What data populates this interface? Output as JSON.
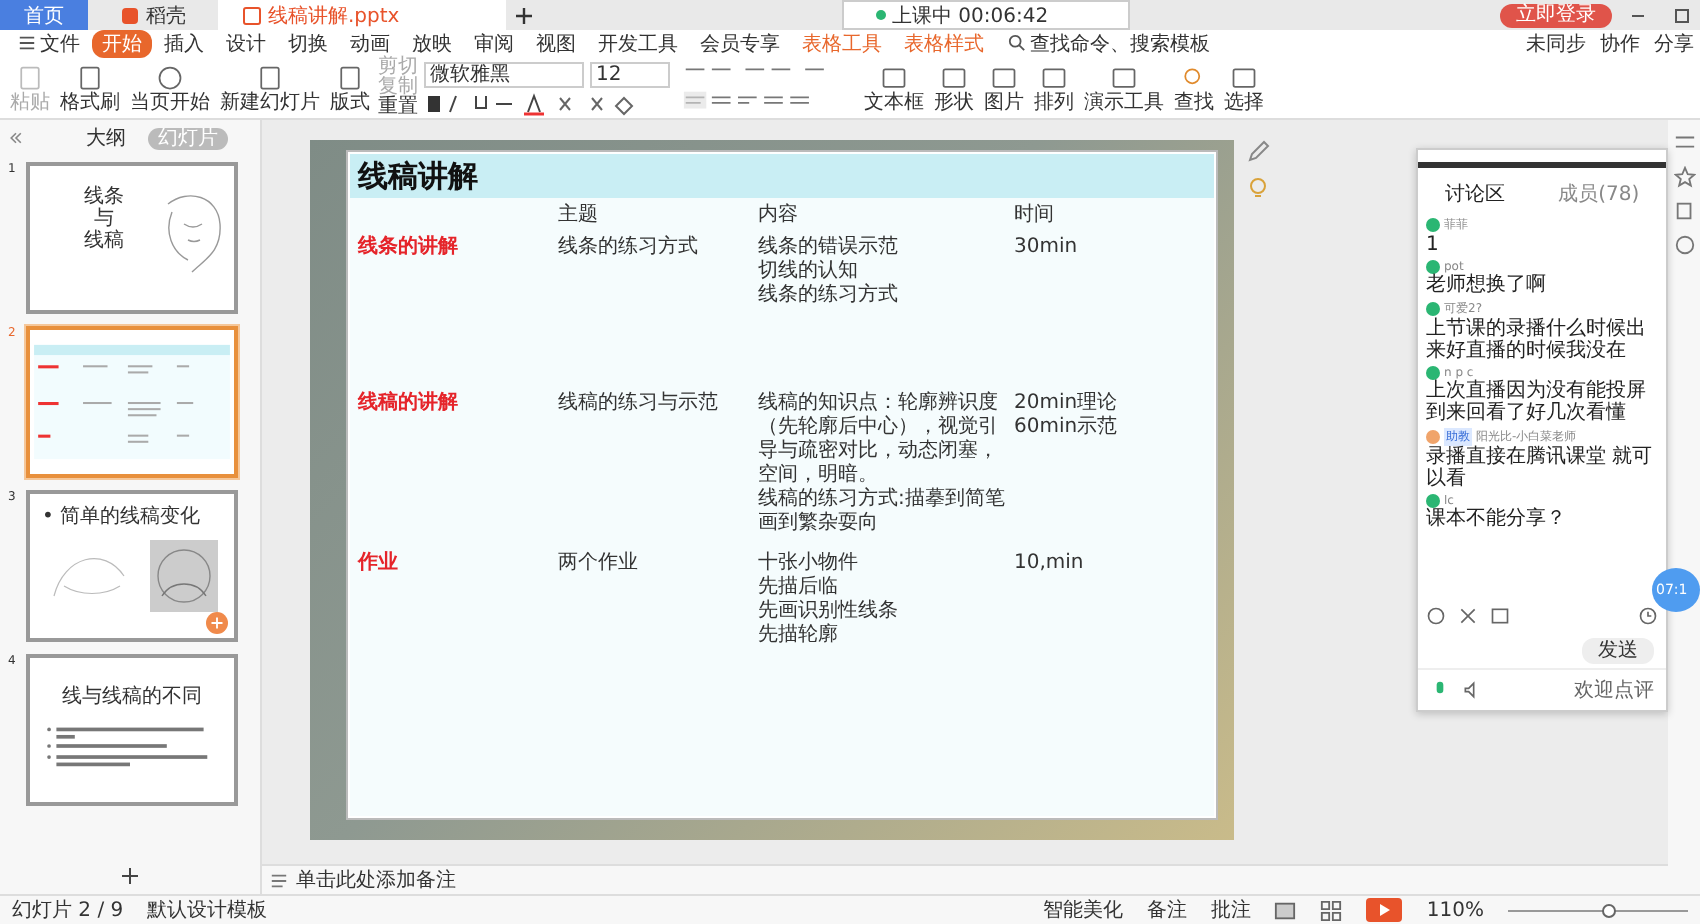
{
  "title_bar": {
    "tabs": [
      {
        "label": "首页",
        "kind": "home",
        "selected": false
      },
      {
        "label": "稻壳",
        "kind": "docer",
        "selected": false
      },
      {
        "label": "线稿讲解.pptx",
        "kind": "file",
        "selected": true
      }
    ],
    "class_status": "上课中 00:06:42",
    "login": "立即登录"
  },
  "menu": {
    "file": "文件",
    "tabs": [
      {
        "label": "开始",
        "selected": true
      },
      {
        "label": "插入",
        "selected": false
      },
      {
        "label": "设计",
        "selected": false
      },
      {
        "label": "切换",
        "selected": false
      },
      {
        "label": "动画",
        "selected": false
      },
      {
        "label": "放映",
        "selected": false
      },
      {
        "label": "审阅",
        "selected": false
      },
      {
        "label": "视图",
        "selected": false
      },
      {
        "label": "开发工具",
        "selected": false
      },
      {
        "label": "会员专享",
        "selected": false
      },
      {
        "label": "表格工具",
        "selected": false
      },
      {
        "label": "表格样式",
        "selected": false
      }
    ],
    "search": "查找命令、搜索模板",
    "actions": [
      "未同步",
      "协作",
      "分享"
    ]
  },
  "ribbon": {
    "left": [
      {
        "label": "粘贴",
        "kind": "paste",
        "disabled": true
      },
      {
        "label": "格式刷",
        "kind": "brush",
        "disabled": false
      },
      {
        "label": "当页开始",
        "kind": "play",
        "disabled": false
      },
      {
        "label": "新建幻灯片",
        "kind": "slide",
        "disabled": false
      },
      {
        "label": "版式",
        "kind": "layout",
        "disabled": false
      }
    ],
    "small": [
      {
        "label": "剪切",
        "disabled": true
      },
      {
        "label": "复制",
        "disabled": true
      },
      {
        "label": "重置",
        "disabled": false
      }
    ],
    "font": "微软雅黑",
    "size": "12",
    "right": [
      {
        "label": "文本框",
        "kind": "textbox",
        "disabled": false
      },
      {
        "label": "形状",
        "kind": "shape",
        "disabled": false
      },
      {
        "label": "图片",
        "kind": "picture",
        "disabled": false
      },
      {
        "label": "排列",
        "kind": "arrange",
        "disabled": false
      },
      {
        "label": "演示工具",
        "kind": "screen",
        "disabled": false
      },
      {
        "label": "查找",
        "kind": "find",
        "disabled": false
      },
      {
        "label": "选择",
        "kind": "select",
        "disabled": false
      }
    ]
  },
  "slides_panel": {
    "tabs": [
      {
        "label": "大纲",
        "selected": false
      },
      {
        "label": "幻灯片",
        "selected": true
      }
    ],
    "slides": [
      {
        "number": "1",
        "kind": "title",
        "selected": false,
        "lines": [
          "线条",
          "与",
          "线稿"
        ]
      },
      {
        "number": "2",
        "kind": "table",
        "selected": true
      },
      {
        "number": "3",
        "kind": "images",
        "selected": false,
        "lines": [
          "• 简单的线稿变化"
        ]
      },
      {
        "number": "4",
        "kind": "bullets",
        "selected": false,
        "lines": [
          "线与线稿的不同"
        ]
      }
    ]
  },
  "slide": {
    "title": "线稿讲解",
    "columns": [
      "主题",
      "内容",
      "时间"
    ],
    "rows": [
      {
        "heading": "线条的讲解",
        "topic": "线条的练习方式",
        "content": [
          "线条的错误示范",
          "切线的认知",
          "线条的练习方式"
        ],
        "time": [
          "30min"
        ]
      },
      {
        "heading": "线稿的讲解",
        "topic": "线稿的练习与示范",
        "content": [
          "线稿的知识点：轮廓辨识度",
          "（先轮廓后中心），视觉引",
          "导与疏密对比，动态闭塞，",
          "空间，明暗。",
          "线稿的练习方式:描摹到简笔",
          "画到繁杂耍向"
        ],
        "time": [
          "20min理论",
          "60min示范"
        ]
      },
      {
        "heading": "作业",
        "topic": "两个作业",
        "content": [
          "十张小物件",
          "先描后临",
          "先画识别性线条",
          "先描轮廓"
        ],
        "time": [
          "10,min"
        ]
      }
    ]
  },
  "chat": {
    "tabs": [
      {
        "label": "讨论区",
        "selected": true
      },
      {
        "label": "成员(78)",
        "selected": false
      }
    ],
    "messages": [
      {
        "user": "菲菲",
        "kind": "student",
        "text": "1"
      },
      {
        "user": "pot",
        "kind": "student",
        "text": "老师想换了啊"
      },
      {
        "user": "可爱2?",
        "kind": "student",
        "text": "上节课的录播什么时候出来好直播的时候我没在"
      },
      {
        "user": "n p c",
        "kind": "student",
        "text": "上次直播因为没有能投屏到来回看了好几次看懂"
      },
      {
        "user": "阳光比-小白菜老师",
        "kind": "assistant",
        "badge": "助教",
        "text": "录播直接在腾讯课堂 就可以看"
      },
      {
        "user": "lc",
        "kind": "student",
        "text": "课本不能分享？"
      }
    ],
    "send": "发送",
    "footer": "欢迎点评"
  },
  "timer": "07:1",
  "notes": "单击此处添加备注",
  "status_bar": {
    "slide": "幻灯片 2 / 9",
    "template": "默认设计模板",
    "beautify": "智能美化",
    "notes": "备注",
    "comments": "批注",
    "zoom": "110%",
    "zoom_slider": {
      "level": 0.55
    }
  }
}
